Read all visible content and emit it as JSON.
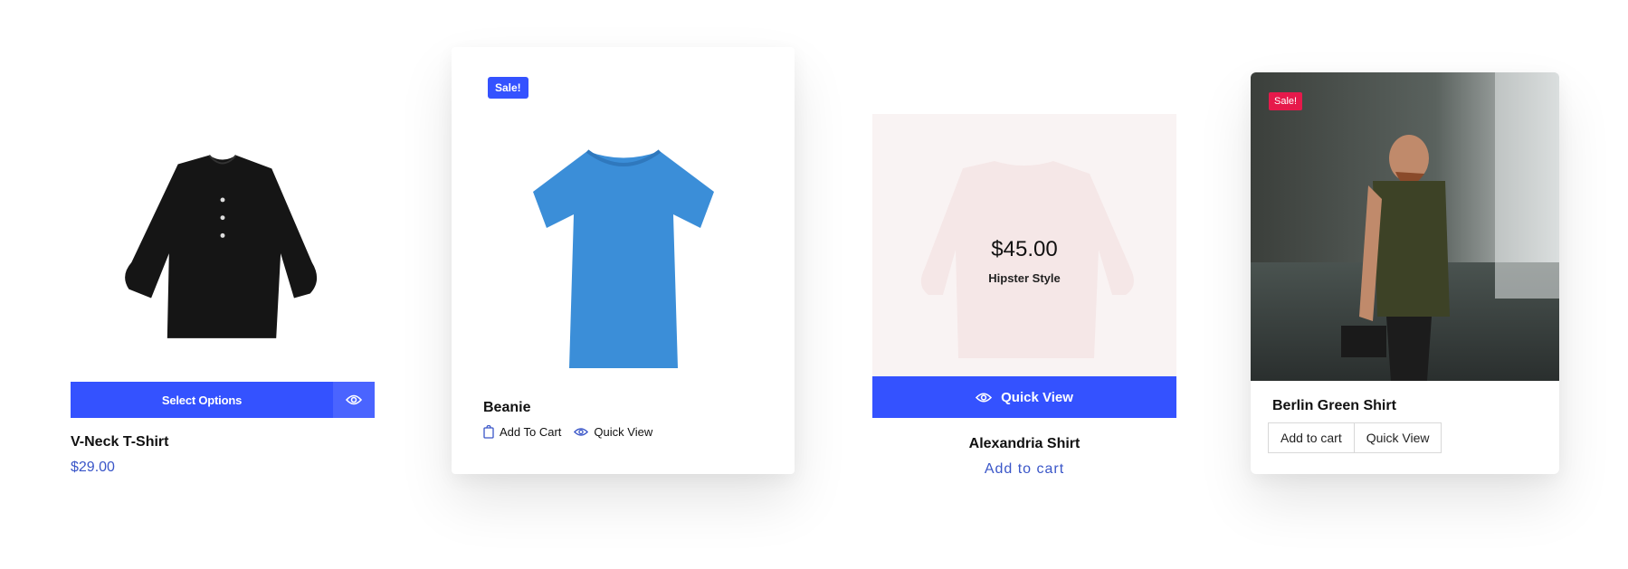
{
  "cards": [
    {
      "title": "V-Neck T-Shirt",
      "price": "$29.00",
      "button_label": "Select Options",
      "icons": [
        "eye-icon"
      ]
    },
    {
      "badge": "Sale!",
      "title": "Beanie",
      "add_to_cart": "Add To Cart",
      "quick_view": "Quick View",
      "icons": [
        "shopping-bag-icon",
        "eye-icon"
      ]
    },
    {
      "overlay_price": "$45.00",
      "overlay_subtitle": "Hipster Style",
      "quick_view": "Quick View",
      "title": "Alexandria Shirt",
      "add_to_cart": "Add to cart",
      "icons": [
        "eye-icon"
      ]
    },
    {
      "badge": "Sale!",
      "title": "Berlin Green Shirt",
      "add_to_cart": "Add to cart",
      "quick_view": "Quick View"
    }
  ],
  "colors": {
    "accent": "#3452ff",
    "price_text": "#3a56c8",
    "sale_badge_red": "#e6194b"
  }
}
